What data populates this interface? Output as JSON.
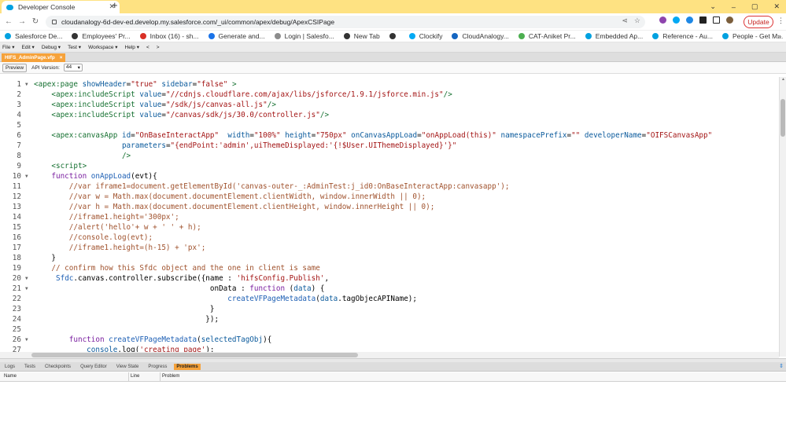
{
  "browser": {
    "tab_title": "Developer Console",
    "new_tab": "+",
    "url": "cloudanalogy-6d-dev-ed.develop.my.salesforce.com/_ui/common/apex/debug/ApexCSIPage",
    "update_label": "Update",
    "window_controls": [
      "⌄",
      "–",
      "▢",
      "✕"
    ]
  },
  "bookmarks": [
    {
      "label": "Salesforce De...",
      "color": "#00a1e0"
    },
    {
      "label": "Employees' Pr...",
      "color": "#333333"
    },
    {
      "label": "Inbox (16) - sh...",
      "color": "#d93025"
    },
    {
      "label": "Generate and...",
      "color": "#1a73e8"
    },
    {
      "label": "Login | Salesfo...",
      "color": "#8c8c8c"
    },
    {
      "label": "New Tab",
      "color": "#333333"
    },
    {
      "label": "",
      "color": "#333333"
    },
    {
      "label": "Clockify",
      "color": "#03a9f4"
    },
    {
      "label": "CloudAnalogy...",
      "color": "#1565c0"
    },
    {
      "label": "CAT-Aniket Pr...",
      "color": "#4caf50"
    },
    {
      "label": "Embedded Ap...",
      "color": "#00a1e0"
    },
    {
      "label": "Reference - Au...",
      "color": "#00a1e0"
    },
    {
      "label": "People - Get M...",
      "color": "#00a1e0"
    }
  ],
  "console": {
    "menu": [
      "File ▾",
      "Edit ▾",
      "Debug ▾",
      "Test ▾",
      "Workspace ▾",
      "Help ▾",
      "<",
      ">"
    ],
    "file_tab": "HIFS_AdminPage.vfp",
    "preview_label": "Preview",
    "api_label": "API Version:",
    "api_value": "44",
    "bottom_tabs": [
      "Logs",
      "Tests",
      "Checkpoints",
      "Query Editor",
      "View State",
      "Progress",
      "Problems"
    ],
    "active_bottom_tab": "Problems",
    "problem_columns": [
      "Name",
      "Line",
      "Problem"
    ]
  },
  "code_lines": [
    {
      "n": "1",
      "fold": true,
      "html": "<span class='tag'>&lt;apex:page</span> <span class='attr'>showHeader</span>=<span class='str'>\"true\"</span> <span class='attr'>sidebar</span>=<span class='str'>\"false\"</span> <span class='tag'>&gt;</span>"
    },
    {
      "n": "2",
      "fold": false,
      "html": "    <span class='tag'>&lt;apex:includeScript</span> <span class='attr'>value</span>=<span class='str'>\"//cdnjs.cloudflare.com/ajax/libs/jsforce/1.9.1/jsforce.min.js\"</span><span class='tag'>/&gt;</span>"
    },
    {
      "n": "3",
      "fold": false,
      "html": "    <span class='tag'>&lt;apex:includeScript</span> <span class='attr'>value</span>=<span class='str'>\"/sdk/js/canvas-all.js\"</span><span class='tag'>/&gt;</span>"
    },
    {
      "n": "4",
      "fold": false,
      "html": "    <span class='tag'>&lt;apex:includeScript</span> <span class='attr'>value</span>=<span class='str'>\"/canvas/sdk/js/30.0/controller.js\"</span><span class='tag'>/&gt;</span>"
    },
    {
      "n": "5",
      "fold": false,
      "html": ""
    },
    {
      "n": "6",
      "fold": false,
      "html": "    <span class='tag'>&lt;apex:canvasApp</span> <span class='attr'>id</span>=<span class='str'>\"OnBaseInteractApp\"</span>  <span class='attr'>width</span>=<span class='str'>\"100%\"</span> <span class='attr'>height</span>=<span class='str'>\"750px\"</span> <span class='attr'>onCanvasAppLoad</span>=<span class='str'>\"onAppLoad(this)\"</span> <span class='attr'>namespacePrefix</span>=<span class='str'>\"\"</span> <span class='attr'>developerName</span>=<span class='str'>\"OIFSCanvasApp\"</span>"
    },
    {
      "n": "7",
      "fold": false,
      "html": "                    <span class='attr'>parameters</span>=<span class='str'>\"{endPoint:'admin',uiThemeDisplayed:'{!$User.UIThemeDisplayed}'}\"</span>"
    },
    {
      "n": "8",
      "fold": false,
      "html": "                    <span class='tag'>/&gt;</span>"
    },
    {
      "n": "9",
      "fold": false,
      "html": "    <span class='tag'>&lt;script&gt;</span>"
    },
    {
      "n": "10",
      "fold": true,
      "html": "    <span class='kw'>function</span> <span class='fn'>onAppLoad</span>(evt){"
    },
    {
      "n": "11",
      "fold": false,
      "html": "        <span class='cmt'>//var iframe1=document.getElementById('canvas-outer-_:AdminTest:j_id0:OnBaseInteractApp:canvasapp');</span>"
    },
    {
      "n": "12",
      "fold": false,
      "html": "        <span class='cmt'>//var w = Math.max(document.documentElement.clientWidth, window.innerWidth || 0);</span>"
    },
    {
      "n": "13",
      "fold": false,
      "html": "        <span class='cmt'>//var h = Math.max(document.documentElement.clientHeight, window.innerHeight || 0);</span>"
    },
    {
      "n": "14",
      "fold": false,
      "html": "        <span class='cmt'>//iframe1.height='300px';</span>"
    },
    {
      "n": "15",
      "fold": false,
      "html": "        <span class='cmt'>//alert('hello'+ w + ' ' + h);</span>"
    },
    {
      "n": "16",
      "fold": false,
      "html": "        <span class='cmt'>//console.log(evt);</span>"
    },
    {
      "n": "17",
      "fold": false,
      "html": "        <span class='cmt'>//iframe1.height=(h-15) + 'px';</span>"
    },
    {
      "n": "18",
      "fold": false,
      "html": "    }"
    },
    {
      "n": "19",
      "fold": false,
      "html": "    <span class='cmt'>// confirm how this Sfdc object and the one in client is same</span>"
    },
    {
      "n": "20",
      "fold": true,
      "html": "     <span class='fn'>Sfdc</span>.canvas.controller.subscribe({name : <span class='str'>'hifsConfig.Publish'</span>,"
    },
    {
      "n": "21",
      "fold": true,
      "html": "                                        onData : <span class='kw'>function</span> (<span class='attr'>data</span>) {"
    },
    {
      "n": "22",
      "fold": false,
      "html": "                                            <span class='fn'>createVFPageMetadata</span>(<span class='attr'>data</span>.tagObjecAPIName);"
    },
    {
      "n": "23",
      "fold": false,
      "html": "                                        }"
    },
    {
      "n": "24",
      "fold": false,
      "html": "                                       });"
    },
    {
      "n": "25",
      "fold": false,
      "html": ""
    },
    {
      "n": "26",
      "fold": true,
      "html": "        <span class='kw'>function</span> <span class='fn'>createVFPageMetadata</span>(<span class='attr'>selectedTagObj</span>){"
    },
    {
      "n": "27",
      "fold": false,
      "html": "            <span class='attr'>console</span>.log(<span class='str'>'creating page'</span>);"
    }
  ]
}
